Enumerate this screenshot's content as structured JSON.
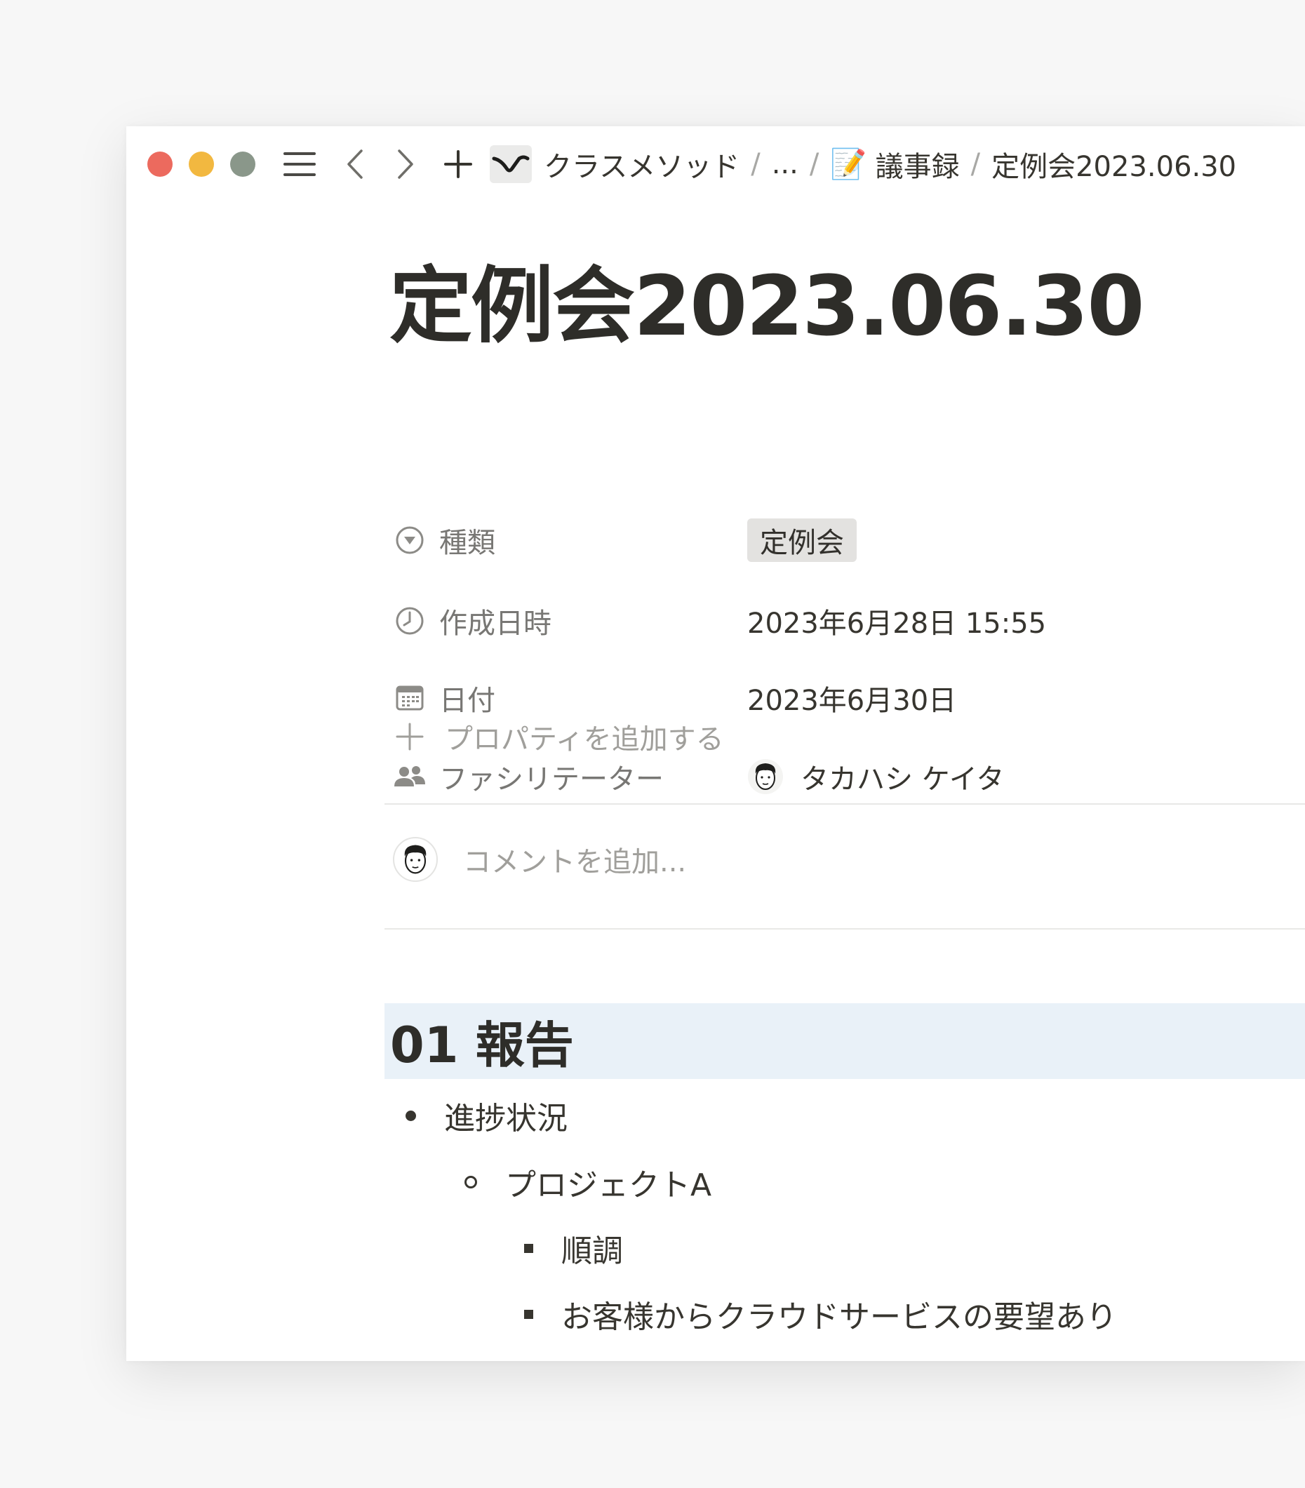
{
  "breadcrumb": {
    "workspace": "クラスメソッド",
    "ellipsis": "...",
    "emoji": "📝",
    "parent": "議事録",
    "current": "定例会2023.06.30",
    "separator": "/"
  },
  "page": {
    "title": "定例会2023.06.30"
  },
  "properties": [
    {
      "icon": "select-icon",
      "name": "種類",
      "value": "定例会",
      "type": "tag"
    },
    {
      "icon": "clock-icon",
      "name": "作成日時",
      "value": "2023年6月28日 15:55"
    },
    {
      "icon": "calendar-icon",
      "name": "日付",
      "value": "2023年6月30日"
    },
    {
      "icon": "people-icon",
      "name": "ファシリテーター",
      "value": "タカハシ ケイタ",
      "type": "person"
    }
  ],
  "add_property_label": "プロパティを追加する",
  "comment_placeholder": "コメントを追加...",
  "content": {
    "heading": "01 報告",
    "list": [
      {
        "level": 1,
        "text": "進捗状況"
      },
      {
        "level": 2,
        "text": "プロジェクトA"
      },
      {
        "level": 3,
        "text": "順調"
      },
      {
        "level": 3,
        "text": "お客様からクラウドサービスの要望あり"
      }
    ]
  },
  "colors": {
    "close": "#ec6a5e",
    "minimize": "#f2b840",
    "maximize": "#8a978a",
    "heading_background": "#e9f1f8",
    "tag_background": "#e3e2e0"
  }
}
